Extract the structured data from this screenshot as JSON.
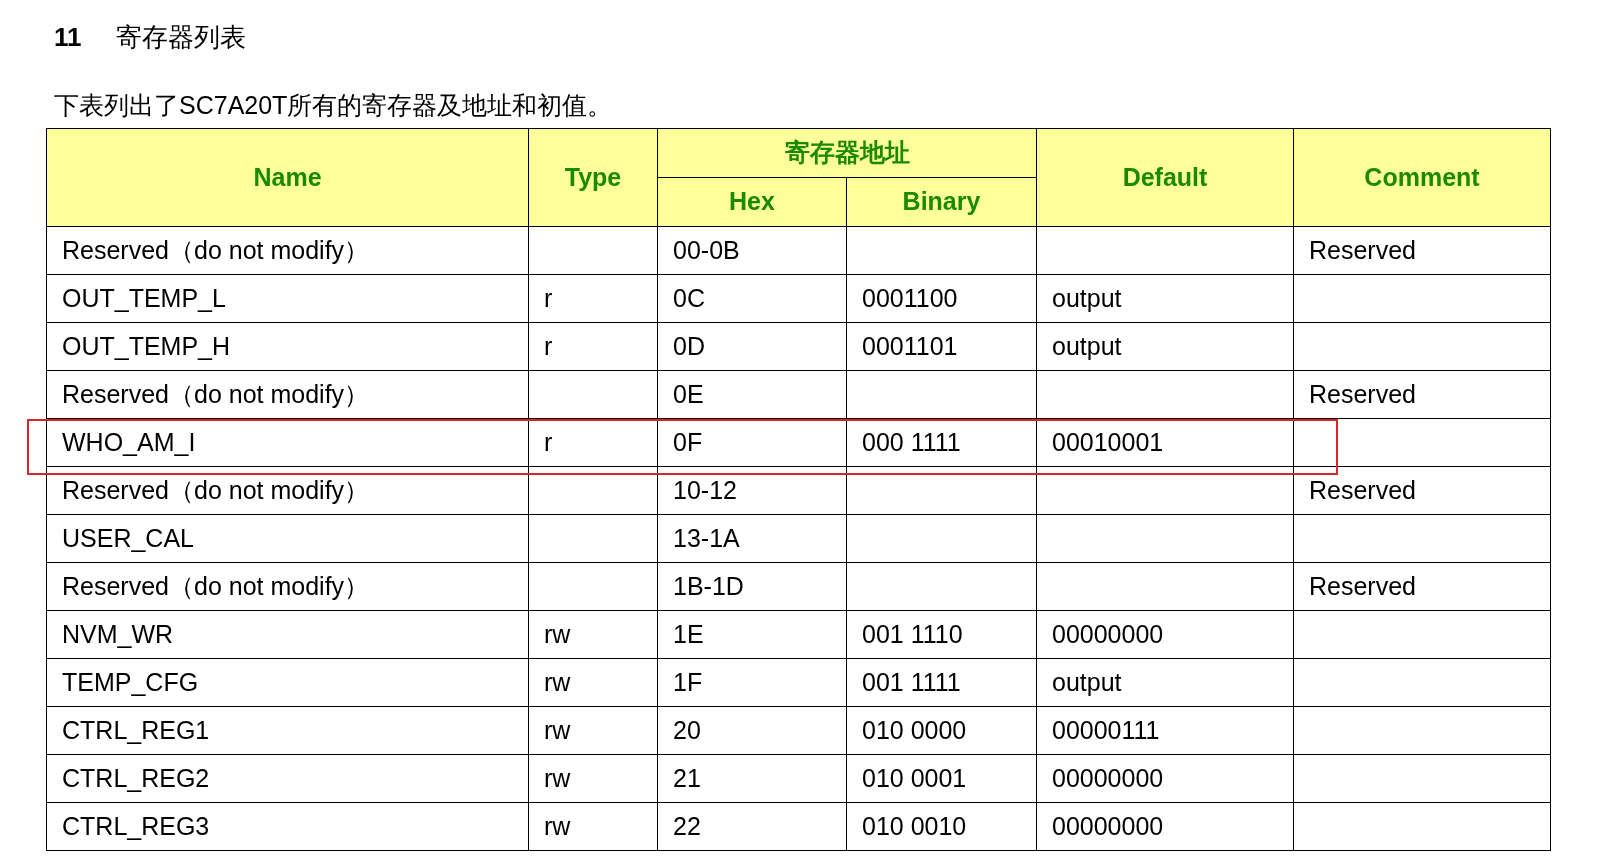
{
  "section": {
    "number": "11",
    "title": "寄存器列表"
  },
  "intro": "下表列出了SC7A20T所有的寄存器及地址和初值。",
  "table": {
    "columns": {
      "name": "Name",
      "type": "Type",
      "address_group": "寄存器地址",
      "hex": "Hex",
      "binary": "Binary",
      "default": "Default",
      "comment": "Comment"
    },
    "rows": [
      {
        "name": "Reserved（do not modify）",
        "hex": "00-0B",
        "comment": "Reserved",
        "highlighted": false
      },
      {
        "name": "OUT_TEMP_L",
        "type": "r",
        "hex": "0C",
        "binary": "0001100",
        "default": "output",
        "highlighted": false
      },
      {
        "name": "OUT_TEMP_H",
        "type": "r",
        "hex": "0D",
        "binary": "0001101",
        "default": "output",
        "highlighted": false
      },
      {
        "name": "Reserved（do not modify）",
        "hex": "0E",
        "comment": "Reserved",
        "highlighted": false
      },
      {
        "name": "WHO_AM_I",
        "type": "r",
        "hex": "0F",
        "binary": "000 1111",
        "default": "00010001",
        "highlighted": true
      },
      {
        "name": "Reserved（do not modify）",
        "hex": "10-12",
        "comment": "Reserved",
        "highlighted": false
      },
      {
        "name": "USER_CAL",
        "hex": "13-1A",
        "highlighted": false
      },
      {
        "name": "Reserved（do not modify）",
        "hex": "1B-1D",
        "comment": "Reserved",
        "highlighted": false
      },
      {
        "name": "NVM_WR",
        "type": "rw",
        "hex": "1E",
        "binary": "001 1110",
        "default": "00000000",
        "highlighted": false
      },
      {
        "name": "TEMP_CFG",
        "type": "rw",
        "hex": "1F",
        "binary": "001 1111",
        "default": "output",
        "highlighted": false
      },
      {
        "name": "CTRL_REG1",
        "type": "rw",
        "hex": "20",
        "binary": "010 0000",
        "default": "00000111",
        "highlighted": false
      },
      {
        "name": "CTRL_REG2",
        "type": "rw",
        "hex": "21",
        "binary": "010 0001",
        "default": "00000000",
        "highlighted": false
      },
      {
        "name": "CTRL_REG3",
        "type": "rw",
        "hex": "22",
        "binary": "010 0010",
        "default": "00000000",
        "highlighted": false
      }
    ]
  }
}
